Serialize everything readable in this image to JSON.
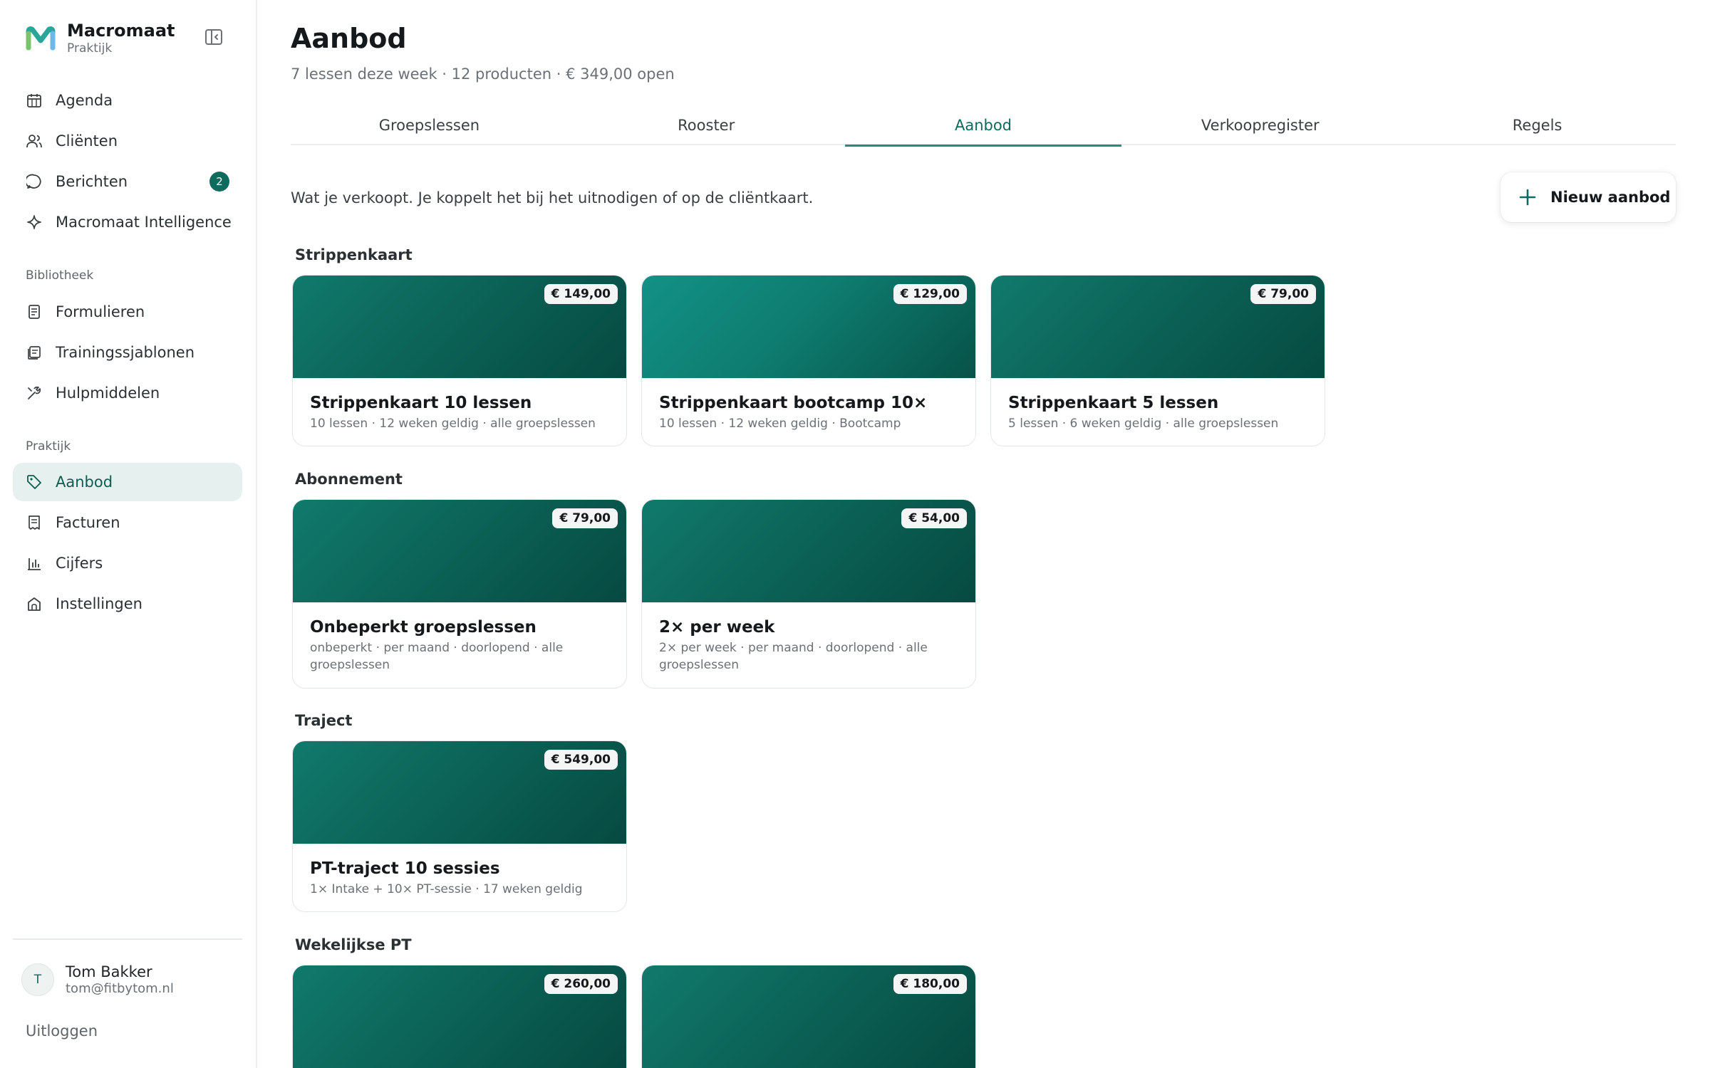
{
  "brand": {
    "name": "Macromaat",
    "sub": "Praktijk"
  },
  "nav_main": [
    {
      "label": "Agenda",
      "icon": "calendar-icon"
    },
    {
      "label": "Cliënten",
      "icon": "users-icon"
    },
    {
      "label": "Berichten",
      "icon": "message-icon",
      "badge": "2"
    },
    {
      "label": "Macromaat Intelligence",
      "icon": "sparkle-icon"
    }
  ],
  "section_library": "Bibliotheek",
  "nav_library": [
    {
      "label": "Formulieren",
      "icon": "form-icon"
    },
    {
      "label": "Trainingssjablonen",
      "icon": "template-icon"
    },
    {
      "label": "Hulpmiddelen",
      "icon": "tools-icon"
    }
  ],
  "section_practice": "Praktijk",
  "nav_practice": [
    {
      "label": "Aanbod",
      "icon": "tag-icon",
      "active": true
    },
    {
      "label": "Facturen",
      "icon": "invoice-icon"
    },
    {
      "label": "Cijfers",
      "icon": "chart-icon"
    },
    {
      "label": "Instellingen",
      "icon": "home-icon"
    }
  ],
  "user": {
    "initial": "T",
    "name": "Tom Bakker",
    "email": "tom@fitbytom.nl"
  },
  "logout": "Uitloggen",
  "page": {
    "title": "Aanbod",
    "subtitle": "7 lessen deze week · 12 producten · € 349,00 open",
    "intro": "Wat je verkoopt. Je koppelt het bij het uitnodigen of op de cliëntkaart.",
    "new_button": "Nieuw aanbod"
  },
  "tabs": [
    {
      "label": "Groepslessen"
    },
    {
      "label": "Rooster"
    },
    {
      "label": "Aanbod",
      "active": true
    },
    {
      "label": "Verkoopregister"
    },
    {
      "label": "Regels"
    }
  ],
  "groups": [
    {
      "title": "Strippenkaart",
      "cards": [
        {
          "price": "€ 149,00",
          "title": "Strippenkaart 10 lessen",
          "desc": "10 lessen · 12 weken geldig · alle groepslessen"
        },
        {
          "price": "€ 129,00",
          "title": "Strippenkaart bootcamp 10×",
          "desc": "10 lessen · 12 weken geldig · Bootcamp"
        },
        {
          "price": "€ 79,00",
          "title": "Strippenkaart 5 lessen",
          "desc": "5 lessen · 6 weken geldig · alle groepslessen"
        }
      ]
    },
    {
      "title": "Abonnement",
      "cards": [
        {
          "price": "€ 79,00",
          "title": "Onbeperkt groepslessen",
          "desc": "onbeperkt · per maand · doorlopend · alle groepslessen"
        },
        {
          "price": "€ 54,00",
          "title": "2× per week",
          "desc": "2× per week · per maand · doorlopend · alle groepslessen"
        }
      ]
    },
    {
      "title": "Traject",
      "cards": [
        {
          "price": "€ 549,00",
          "title": "PT-traject 10 sessies",
          "desc": "1× Intake + 10× PT-sessie · 17 weken geldig"
        }
      ]
    },
    {
      "title": "Wekelijkse PT",
      "cards": [
        {
          "price": "€ 260,00",
          "title": "",
          "desc": ""
        },
        {
          "price": "€ 180,00",
          "title": "",
          "desc": ""
        }
      ]
    }
  ]
}
